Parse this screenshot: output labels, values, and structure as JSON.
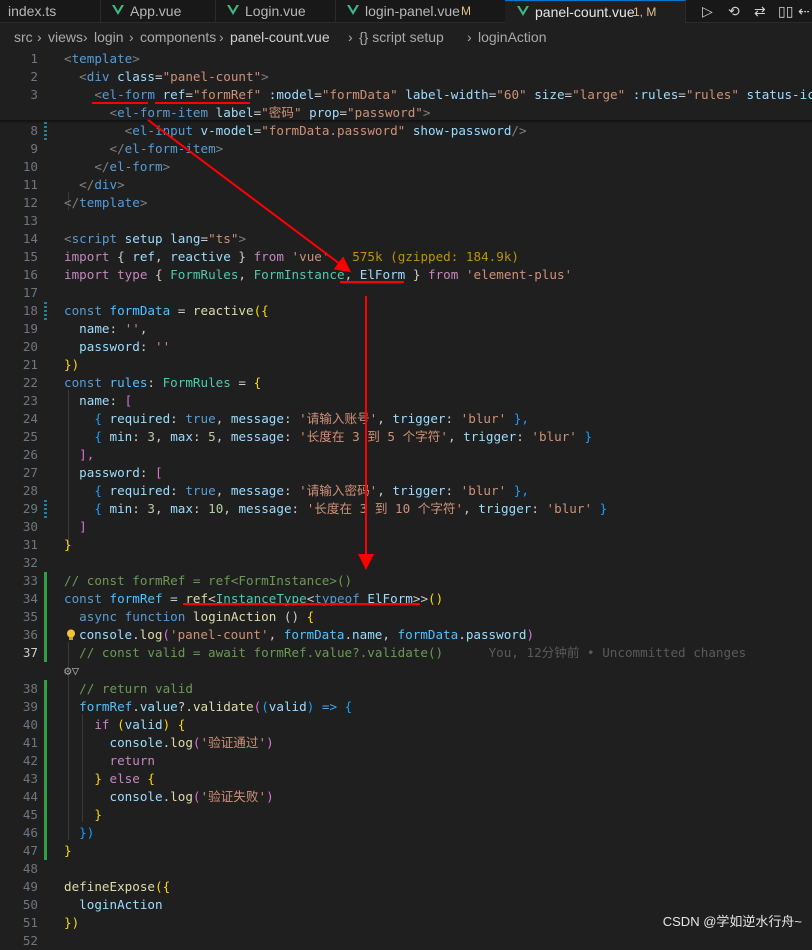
{
  "tabs": [
    {
      "name": "index.ts",
      "icon": "ts-file-icon"
    },
    {
      "name": "App.vue",
      "icon": "vue-file-icon"
    },
    {
      "name": "Login.vue",
      "icon": "vue-file-icon"
    },
    {
      "name": "login-panel.vue",
      "icon": "vue-file-icon",
      "modified": "M"
    },
    {
      "name": "panel-count.vue",
      "icon": "vue-file-icon",
      "modified": "1, M",
      "active": true
    }
  ],
  "toolbar": [
    {
      "name": "run-icon",
      "glyph": "▷"
    },
    {
      "name": "timeline-icon",
      "glyph": "⟲"
    },
    {
      "name": "compare-changes-icon",
      "glyph": "⇄"
    },
    {
      "name": "split-editor-icon",
      "glyph": "▯▯"
    },
    {
      "name": "go-back-icon",
      "glyph": "⇠"
    }
  ],
  "breadcrumb": [
    {
      "text": "src",
      "kind": "folder"
    },
    {
      "text": "views",
      "kind": "folder"
    },
    {
      "text": "login",
      "kind": "folder"
    },
    {
      "text": "components",
      "kind": "folder"
    },
    {
      "text": "panel-count.vue",
      "kind": "file"
    },
    {
      "text": "{} script setup",
      "kind": "symbol"
    },
    {
      "text": "loginAction",
      "kind": "method"
    }
  ],
  "lines": [
    {
      "n": "1",
      "t": [
        [
          "<",
          "#808080"
        ],
        [
          "template",
          "#569cd6"
        ],
        [
          ">",
          "#808080"
        ]
      ]
    },
    {
      "n": "2",
      "t": [
        [
          "  <",
          "#808080"
        ],
        [
          "div",
          "#569cd6"
        ],
        [
          " class",
          "#9cdcfe"
        ],
        [
          "=",
          "#cccccc"
        ],
        [
          "\"panel-count\"",
          "#ce9178"
        ],
        [
          ">",
          "#808080"
        ]
      ]
    },
    {
      "n": "3",
      "t": [
        [
          "    <",
          "#808080"
        ],
        [
          "el-form",
          "#569cd6"
        ],
        [
          " ref",
          "#9cdcfe"
        ],
        [
          "=",
          "#cccccc"
        ],
        [
          "\"formRef\"",
          "#ce9178"
        ],
        [
          " :model",
          "#9cdcfe"
        ],
        [
          "=",
          "#cccccc"
        ],
        [
          "\"formData\"",
          "#ce9178"
        ],
        [
          " label-width",
          "#9cdcfe"
        ],
        [
          "=",
          "#cccccc"
        ],
        [
          "\"60\"",
          "#ce9178"
        ],
        [
          " size",
          "#9cdcfe"
        ],
        [
          "=",
          "#cccccc"
        ],
        [
          "\"large\"",
          "#ce9178"
        ],
        [
          " :rules",
          "#9cdcfe"
        ],
        [
          "=",
          "#cccccc"
        ],
        [
          "\"rules\"",
          "#ce9178"
        ],
        [
          " status-icon",
          "#9cdcfe"
        ],
        [
          ">",
          "#808080"
        ]
      ]
    },
    {
      "n": "",
      "t": [
        [
          "      <",
          "#808080"
        ],
        [
          "el-form-item",
          "#569cd6"
        ],
        [
          " label",
          "#9cdcfe"
        ],
        [
          "=",
          "#cccccc"
        ],
        [
          "\"密码\"",
          "#ce9178"
        ],
        [
          " prop",
          "#9cdcfe"
        ],
        [
          "=",
          "#cccccc"
        ],
        [
          "\"password\"",
          "#ce9178"
        ],
        [
          ">",
          "#808080"
        ]
      ]
    },
    {
      "n": "8",
      "g": "mod",
      "t": [
        [
          "        <",
          "#808080"
        ],
        [
          "el-input",
          "#569cd6"
        ],
        [
          " v-model",
          "#9cdcfe"
        ],
        [
          "=",
          "#cccccc"
        ],
        [
          "\"formData.password\"",
          "#ce9178"
        ],
        [
          " show-password",
          "#9cdcfe"
        ],
        [
          "/>",
          "#808080"
        ]
      ]
    },
    {
      "n": "9",
      "t": [
        [
          "      </",
          "#808080"
        ],
        [
          "el-form-item",
          "#569cd6"
        ],
        [
          ">",
          "#808080"
        ]
      ]
    },
    {
      "n": "10",
      "t": [
        [
          "    </",
          "#808080"
        ],
        [
          "el-form",
          "#569cd6"
        ],
        [
          ">",
          "#808080"
        ]
      ]
    },
    {
      "n": "11",
      "t": [
        [
          "  </",
          "#808080"
        ],
        [
          "div",
          "#569cd6"
        ],
        [
          ">",
          "#808080"
        ]
      ]
    },
    {
      "n": "12",
      "t": [
        [
          "</",
          "#808080"
        ],
        [
          "template",
          "#569cd6"
        ],
        [
          ">",
          "#808080"
        ]
      ]
    },
    {
      "n": "13",
      "t": []
    },
    {
      "n": "14",
      "t": [
        [
          "<",
          "#808080"
        ],
        [
          "script",
          "#569cd6"
        ],
        [
          " setup",
          "#9cdcfe"
        ],
        [
          " lang",
          "#9cdcfe"
        ],
        [
          "=",
          "#cccccc"
        ],
        [
          "\"ts\"",
          "#ce9178"
        ],
        [
          ">",
          "#808080"
        ]
      ]
    },
    {
      "n": "15",
      "t": [
        [
          "import",
          "#c586c0"
        ],
        [
          " { ",
          "#cccccc"
        ],
        [
          "ref",
          "#9cdcfe"
        ],
        [
          ", ",
          "#cccccc"
        ],
        [
          "reactive",
          "#9cdcfe"
        ],
        [
          " } ",
          "#cccccc"
        ],
        [
          "from",
          "#c586c0"
        ],
        [
          " ",
          "#cccccc"
        ],
        [
          "'vue'",
          "#ce9178"
        ],
        [
          "   575k (gzipped: 184.9k)",
          "#b89500"
        ]
      ]
    },
    {
      "n": "16",
      "t": [
        [
          "import",
          "#c586c0"
        ],
        [
          " type",
          "#c586c0"
        ],
        [
          " { ",
          "#cccccc"
        ],
        [
          "FormRules",
          "#4ec9b0"
        ],
        [
          ", ",
          "#cccccc"
        ],
        [
          "FormInstance",
          "#4ec9b0"
        ],
        [
          ", ",
          "#cccccc"
        ],
        [
          "ElForm",
          "#9cdcfe"
        ],
        [
          " } ",
          "#cccccc"
        ],
        [
          "from",
          "#c586c0"
        ],
        [
          " ",
          "#cccccc"
        ],
        [
          "'element-plus'",
          "#ce9178"
        ]
      ]
    },
    {
      "n": "17",
      "t": []
    },
    {
      "n": "18",
      "g": "mod",
      "t": [
        [
          "const",
          "#569cd6"
        ],
        [
          " formData",
          "#4fc1ff"
        ],
        [
          " = ",
          "#cccccc"
        ],
        [
          "reactive",
          "#dcdcaa"
        ],
        [
          "({",
          "#ffd700"
        ]
      ]
    },
    {
      "n": "19",
      "t": [
        [
          "  name",
          "#9cdcfe"
        ],
        [
          ": ",
          "#cccccc"
        ],
        [
          "''",
          "#ce9178"
        ],
        [
          ",",
          "#cccccc"
        ]
      ]
    },
    {
      "n": "20",
      "t": [
        [
          "  password",
          "#9cdcfe"
        ],
        [
          ": ",
          "#cccccc"
        ],
        [
          "''",
          "#ce9178"
        ]
      ]
    },
    {
      "n": "21",
      "t": [
        [
          "})",
          "#ffd700"
        ]
      ]
    },
    {
      "n": "22",
      "t": [
        [
          "const",
          "#569cd6"
        ],
        [
          " rules",
          "#4fc1ff"
        ],
        [
          ": ",
          "#cccccc"
        ],
        [
          "FormRules",
          "#4ec9b0"
        ],
        [
          " = ",
          "#cccccc"
        ],
        [
          "{",
          "#ffd700"
        ]
      ]
    },
    {
      "n": "23",
      "t": [
        [
          "  name",
          "#9cdcfe"
        ],
        [
          ": ",
          "#cccccc"
        ],
        [
          "[",
          "#da70d6"
        ]
      ]
    },
    {
      "n": "24",
      "t": [
        [
          "    { ",
          "#179fff"
        ],
        [
          "required",
          "#9cdcfe"
        ],
        [
          ": ",
          "#cccccc"
        ],
        [
          "true",
          "#569cd6"
        ],
        [
          ", ",
          "#cccccc"
        ],
        [
          "message",
          "#9cdcfe"
        ],
        [
          ": ",
          "#cccccc"
        ],
        [
          "'请输入账号'",
          "#ce9178"
        ],
        [
          ", ",
          "#cccccc"
        ],
        [
          "trigger",
          "#9cdcfe"
        ],
        [
          ": ",
          "#cccccc"
        ],
        [
          "'blur'",
          "#ce9178"
        ],
        [
          " },",
          "#179fff"
        ]
      ]
    },
    {
      "n": "25",
      "t": [
        [
          "    { ",
          "#179fff"
        ],
        [
          "min",
          "#9cdcfe"
        ],
        [
          ": ",
          "#cccccc"
        ],
        [
          "3",
          "#b5cea8"
        ],
        [
          ", ",
          "#cccccc"
        ],
        [
          "max",
          "#9cdcfe"
        ],
        [
          ": ",
          "#cccccc"
        ],
        [
          "5",
          "#b5cea8"
        ],
        [
          ", ",
          "#cccccc"
        ],
        [
          "message",
          "#9cdcfe"
        ],
        [
          ": ",
          "#cccccc"
        ],
        [
          "'长度在 3 到 5 个字符'",
          "#ce9178"
        ],
        [
          ", ",
          "#cccccc"
        ],
        [
          "trigger",
          "#9cdcfe"
        ],
        [
          ": ",
          "#cccccc"
        ],
        [
          "'blur'",
          "#ce9178"
        ],
        [
          " }",
          "#179fff"
        ]
      ]
    },
    {
      "n": "26",
      "t": [
        [
          "  ],",
          "#da70d6"
        ]
      ]
    },
    {
      "n": "27",
      "t": [
        [
          "  password",
          "#9cdcfe"
        ],
        [
          ": ",
          "#cccccc"
        ],
        [
          "[",
          "#da70d6"
        ]
      ]
    },
    {
      "n": "28",
      "t": [
        [
          "    { ",
          "#179fff"
        ],
        [
          "required",
          "#9cdcfe"
        ],
        [
          ": ",
          "#cccccc"
        ],
        [
          "true",
          "#569cd6"
        ],
        [
          ", ",
          "#cccccc"
        ],
        [
          "message",
          "#9cdcfe"
        ],
        [
          ": ",
          "#cccccc"
        ],
        [
          "'请输入密码'",
          "#ce9178"
        ],
        [
          ", ",
          "#cccccc"
        ],
        [
          "trigger",
          "#9cdcfe"
        ],
        [
          ": ",
          "#cccccc"
        ],
        [
          "'blur'",
          "#ce9178"
        ],
        [
          " },",
          "#179fff"
        ]
      ]
    },
    {
      "n": "29",
      "g": "mod",
      "t": [
        [
          "    { ",
          "#179fff"
        ],
        [
          "min",
          "#9cdcfe"
        ],
        [
          ": ",
          "#cccccc"
        ],
        [
          "3",
          "#b5cea8"
        ],
        [
          ", ",
          "#cccccc"
        ],
        [
          "max",
          "#9cdcfe"
        ],
        [
          ": ",
          "#cccccc"
        ],
        [
          "10",
          "#b5cea8"
        ],
        [
          ", ",
          "#cccccc"
        ],
        [
          "message",
          "#9cdcfe"
        ],
        [
          ": ",
          "#cccccc"
        ],
        [
          "'长度在 3 到 10 个字符'",
          "#ce9178"
        ],
        [
          ", ",
          "#cccccc"
        ],
        [
          "trigger",
          "#9cdcfe"
        ],
        [
          ": ",
          "#cccccc"
        ],
        [
          "'blur'",
          "#ce9178"
        ],
        [
          " }",
          "#179fff"
        ]
      ]
    },
    {
      "n": "30",
      "t": [
        [
          "  ]",
          "#da70d6"
        ]
      ]
    },
    {
      "n": "31",
      "t": [
        [
          "}",
          "#ffd700"
        ]
      ]
    },
    {
      "n": "32",
      "t": []
    },
    {
      "n": "33",
      "g": "add",
      "t": [
        [
          "// const formRef = ref<FormInstance>()",
          "#6a9955"
        ]
      ]
    },
    {
      "n": "34",
      "g": "add",
      "t": [
        [
          "const",
          "#569cd6"
        ],
        [
          " formRef",
          "#4fc1ff"
        ],
        [
          " = ",
          "#cccccc"
        ],
        [
          "ref",
          "#dcdcaa"
        ],
        [
          "<",
          "#cccccc"
        ],
        [
          "InstanceType",
          "#4ec9b0"
        ],
        [
          "<",
          "#cccccc"
        ],
        [
          "typeof",
          "#569cd6"
        ],
        [
          " ElForm",
          "#9cdcfe"
        ],
        [
          ">>",
          "#cccccc"
        ],
        [
          "()",
          "#ffd700"
        ]
      ]
    },
    {
      "n": "35",
      "g": "add",
      "t": [
        [
          "  async",
          "#569cd6"
        ],
        [
          " function",
          "#569cd6"
        ],
        [
          " loginAction",
          "#dcdcaa"
        ],
        [
          " () ",
          "#cccccc"
        ],
        [
          "{",
          "#ffd700"
        ]
      ]
    },
    {
      "n": "36",
      "g": "add",
      "t": [
        [
          "console",
          "#9cdcfe"
        ],
        [
          ".",
          "#cccccc"
        ],
        [
          "log",
          "#dcdcaa"
        ],
        [
          "(",
          "#da70d6"
        ],
        [
          "'panel-count'",
          "#ce9178"
        ],
        [
          ", ",
          "#cccccc"
        ],
        [
          "formData",
          "#4fc1ff"
        ],
        [
          ".",
          "#cccccc"
        ],
        [
          "name",
          "#9cdcfe"
        ],
        [
          ", ",
          "#cccccc"
        ],
        [
          "formData",
          "#4fc1ff"
        ],
        [
          ".",
          "#cccccc"
        ],
        [
          "password",
          "#9cdcfe"
        ],
        [
          ")",
          "#da70d6"
        ]
      ]
    },
    {
      "n": "37",
      "g": "add",
      "cur": true,
      "t": [
        [
          "  // const valid = await formRef.value?.validate()",
          "#6a9955"
        ],
        [
          "      You, 12分钟前 • Uncommitted changes",
          "#5a5a5a"
        ]
      ]
    },
    {
      "n": "38",
      "g": "add",
      "t": [
        [
          "  // return valid",
          "#6a9955"
        ]
      ]
    },
    {
      "n": "39",
      "g": "add",
      "t": [
        [
          "  formRef",
          "#4fc1ff"
        ],
        [
          ".",
          "#cccccc"
        ],
        [
          "value",
          "#9cdcfe"
        ],
        [
          "?.",
          "#cccccc"
        ],
        [
          "validate",
          "#dcdcaa"
        ],
        [
          "(",
          "#da70d6"
        ],
        [
          "(",
          "#179fff"
        ],
        [
          "valid",
          "#9cdcfe"
        ],
        [
          ") ",
          "#179fff"
        ],
        [
          "=> ",
          "#569cd6"
        ],
        [
          "{",
          "#179fff"
        ]
      ]
    },
    {
      "n": "40",
      "g": "add",
      "t": [
        [
          "    if",
          "#c586c0"
        ],
        [
          " (",
          "#ffd700"
        ],
        [
          "valid",
          "#9cdcfe"
        ],
        [
          ") ",
          "#ffd700"
        ],
        [
          "{",
          "#ffd700"
        ]
      ]
    },
    {
      "n": "41",
      "g": "add",
      "t": [
        [
          "      console",
          "#9cdcfe"
        ],
        [
          ".",
          "#cccccc"
        ],
        [
          "log",
          "#dcdcaa"
        ],
        [
          "(",
          "#da70d6"
        ],
        [
          "'验证通过'",
          "#ce9178"
        ],
        [
          ")",
          "#da70d6"
        ]
      ]
    },
    {
      "n": "42",
      "g": "add",
      "t": [
        [
          "      return",
          "#c586c0"
        ]
      ]
    },
    {
      "n": "43",
      "g": "add",
      "t": [
        [
          "    } ",
          "#ffd700"
        ],
        [
          "else",
          "#c586c0"
        ],
        [
          " {",
          "#ffd700"
        ]
      ]
    },
    {
      "n": "44",
      "g": "add",
      "t": [
        [
          "      console",
          "#9cdcfe"
        ],
        [
          ".",
          "#cccccc"
        ],
        [
          "log",
          "#dcdcaa"
        ],
        [
          "(",
          "#da70d6"
        ],
        [
          "'验证失败'",
          "#ce9178"
        ],
        [
          ")",
          "#da70d6"
        ]
      ]
    },
    {
      "n": "45",
      "g": "add",
      "t": [
        [
          "    }",
          "#ffd700"
        ]
      ]
    },
    {
      "n": "46",
      "g": "add",
      "t": [
        [
          "  })",
          "#179fff"
        ]
      ]
    },
    {
      "n": "47",
      "g": "add",
      "t": [
        [
          "}",
          "#ffd700"
        ]
      ]
    },
    {
      "n": "48",
      "t": []
    },
    {
      "n": "49",
      "t": [
        [
          "defineExpose",
          "#dcdcaa"
        ],
        [
          "({",
          "#ffd700"
        ]
      ]
    },
    {
      "n": "50",
      "t": [
        [
          "  loginAction",
          "#9cdcfe"
        ]
      ]
    },
    {
      "n": "51",
      "t": [
        [
          "})",
          "#ffd700"
        ]
      ]
    },
    {
      "n": "52",
      "t": []
    }
  ],
  "codelens": "⚙▽",
  "watermark": "CSDN @学如逆水行舟~",
  "colors": {
    "annotation": "#ff0000",
    "tab_modified": "#e2c08d",
    "accent": "#0078d4"
  }
}
